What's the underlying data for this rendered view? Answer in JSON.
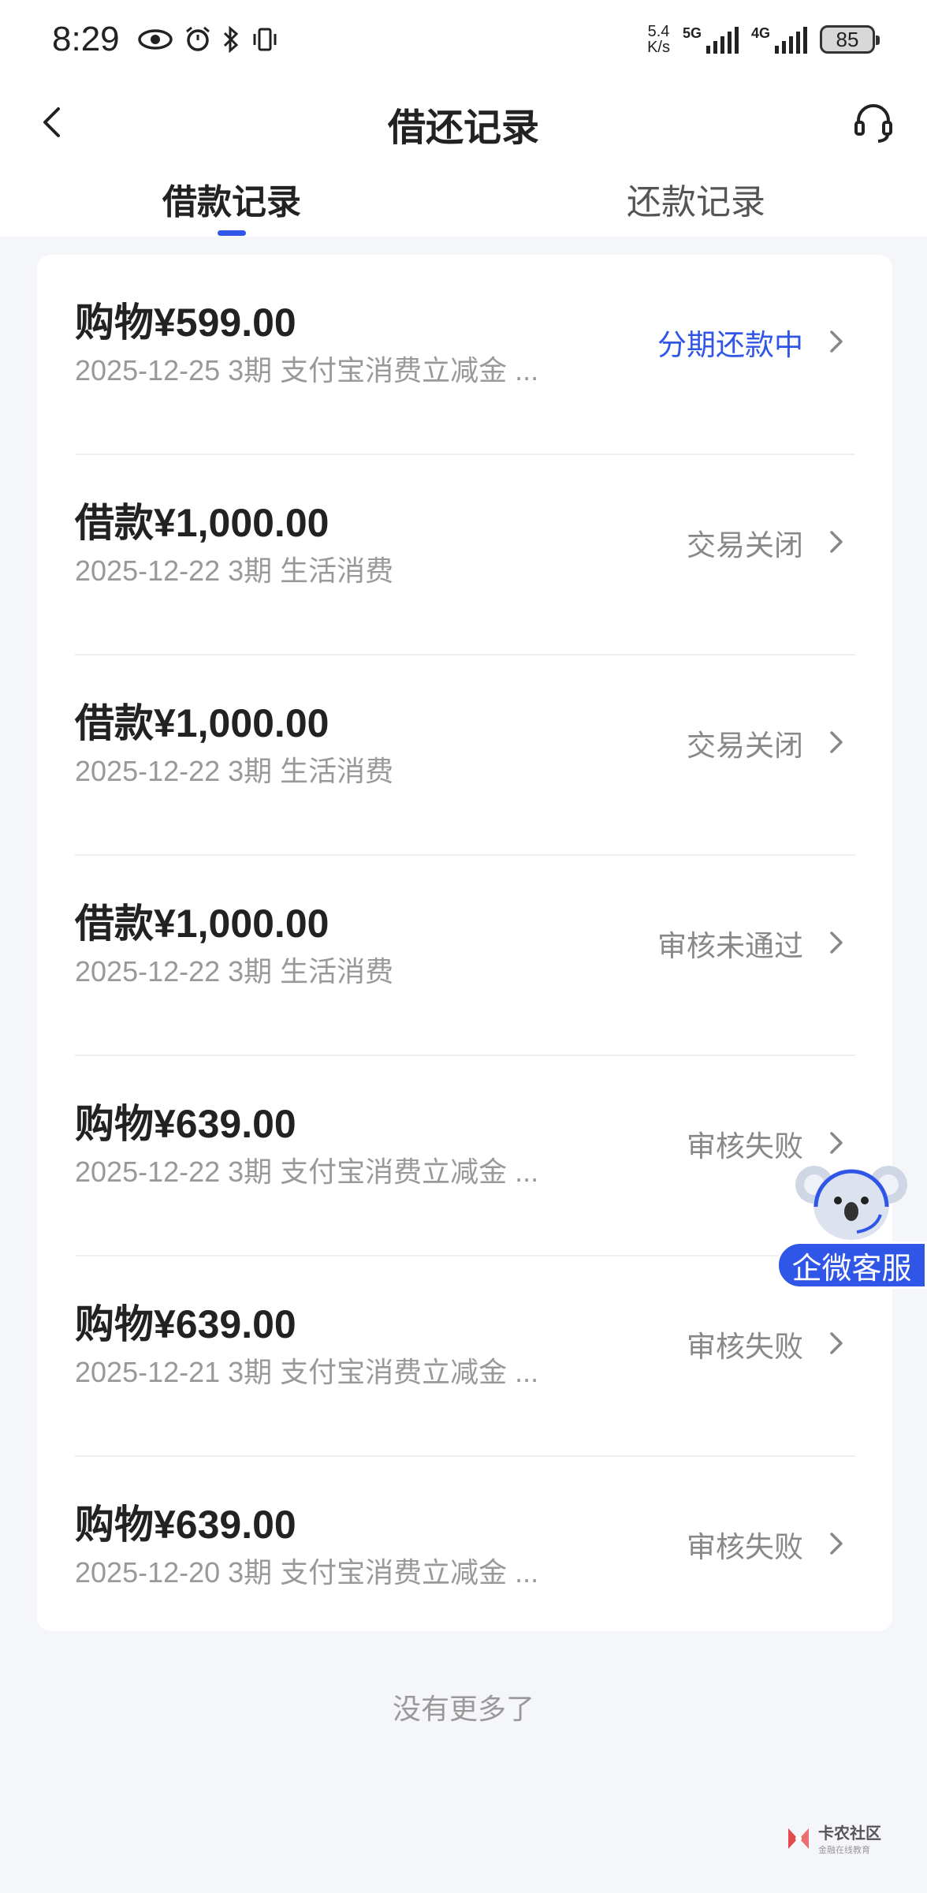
{
  "status_bar": {
    "time": "8:29",
    "speed_value": "5.4",
    "speed_unit": "K/s",
    "network_5g": "5G",
    "network_4g": "4G",
    "battery": "85"
  },
  "header": {
    "title": "借还记录",
    "tabs": [
      {
        "label": "借款记录",
        "active": true
      },
      {
        "label": "还款记录",
        "active": false
      }
    ]
  },
  "records": [
    {
      "title": "购物¥599.00",
      "subtitle": "2025-12-25 3期  支付宝消费立减金 ...",
      "status": "分期还款中",
      "status_active": true
    },
    {
      "title": "借款¥1,000.00",
      "subtitle": "2025-12-22 3期  生活消费",
      "status": "交易关闭",
      "status_active": false
    },
    {
      "title": "借款¥1,000.00",
      "subtitle": "2025-12-22 3期  生活消费",
      "status": "交易关闭",
      "status_active": false
    },
    {
      "title": "借款¥1,000.00",
      "subtitle": "2025-12-22 3期  生活消费",
      "status": "审核未通过",
      "status_active": false
    },
    {
      "title": "购物¥639.00",
      "subtitle": "2025-12-22 3期  支付宝消费立减金 ...",
      "status": "审核失败",
      "status_active": false
    },
    {
      "title": "购物¥639.00",
      "subtitle": "2025-12-21 3期  支付宝消费立减金 ...",
      "status": "审核失败",
      "status_active": false
    },
    {
      "title": "购物¥639.00",
      "subtitle": "2025-12-20 3期  支付宝消费立减金 ...",
      "status": "审核失败",
      "status_active": false
    }
  ],
  "footer_message": "没有更多了",
  "floating_service": {
    "label": "企微客服"
  },
  "watermark": {
    "main": "卡农社区",
    "sub": "金融在线教育"
  },
  "colors": {
    "accent": "#2f56e6",
    "muted": "#999999",
    "background": "#f5f6fa"
  }
}
